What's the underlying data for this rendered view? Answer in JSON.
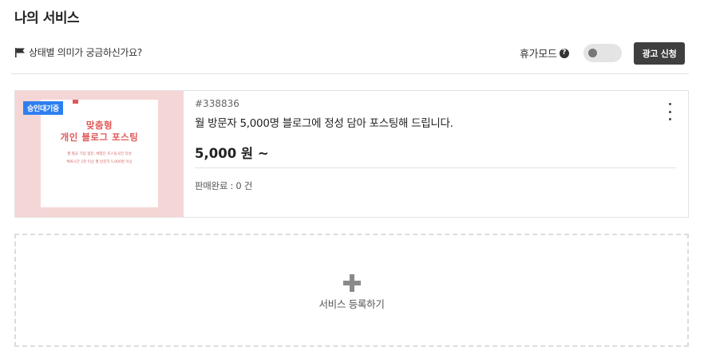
{
  "header": {
    "title": "나의 서비스",
    "status_help_label": "상태별 의미가 궁금하신가요?",
    "vacation_mode_label": "휴가모드",
    "vacation_mode_on": false,
    "ad_apply_label": "광고 신청"
  },
  "services": [
    {
      "status": "승인대기중",
      "id": "#338836",
      "title": "월 방문자 5,000명 블로그에 정성 담아 포스팅해 드립니다.",
      "price": "5,000 원 ~",
      "sales": "판매완료 : 0 건",
      "thumbnail": {
        "title_line1": "맞춤형",
        "title_line2": "개인 블로그 포스팅",
        "sub_line1": "월 평균 기업 협찬, 체험단 포스팅 8건 작성",
        "sub_line2": "체류시간 2분 이상 월 방문자 5,000명 이상"
      }
    }
  ],
  "add_service_label": "서비스 등록하기",
  "icons": {
    "flag": "flag-icon",
    "help": "question-circle-icon",
    "more": "more-vertical-icon",
    "plus": "plus-icon"
  },
  "colors": {
    "badge": "#2f7ef0",
    "thumbnail_bg": "#f5d6d6",
    "thumbnail_text": "#e05a5a",
    "ad_button": "#3f3f3f"
  }
}
